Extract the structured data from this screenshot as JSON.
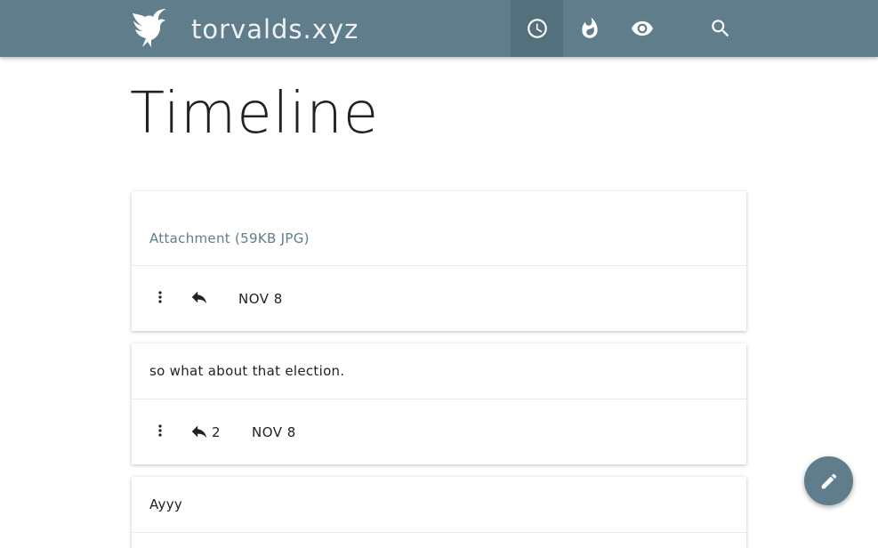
{
  "header": {
    "site_name": "torvalds.xyz",
    "nav": [
      {
        "icon": "clock-icon",
        "active": true
      },
      {
        "icon": "flame-icon",
        "active": false
      },
      {
        "icon": "eye-icon",
        "active": false
      },
      {
        "icon": "search-icon",
        "active": false
      }
    ]
  },
  "page": {
    "title": "Timeline"
  },
  "posts": [
    {
      "text": "Attachment (59KB JPG)",
      "is_attachment": true,
      "reply_count": "",
      "date": "NOV 8"
    },
    {
      "text": "so what about that election.",
      "is_attachment": false,
      "reply_count": "2",
      "date": "NOV 8"
    },
    {
      "text": "Ayyy",
      "is_attachment": false,
      "reply_count": "",
      "date": ""
    }
  ],
  "colors": {
    "accent": "#607d8b",
    "active_nav": "#55707d"
  }
}
